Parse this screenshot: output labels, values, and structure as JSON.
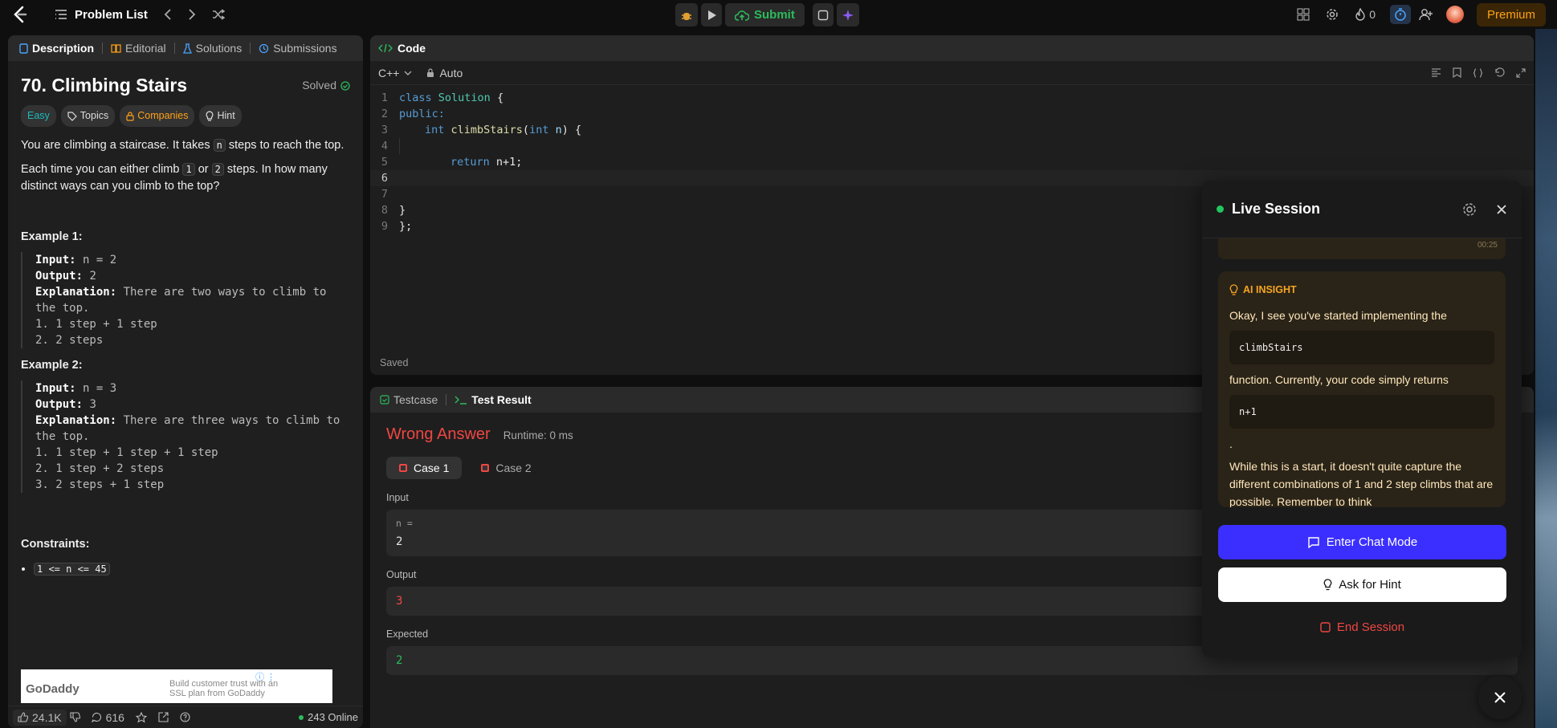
{
  "topbar": {
    "title": "Problem List",
    "submit": "Submit",
    "streak": "0",
    "premium": "Premium"
  },
  "left": {
    "tabs": [
      "Description",
      "Editorial",
      "Solutions",
      "Submissions"
    ],
    "title": "70. Climbing Stairs",
    "status": "Solved",
    "tags": [
      "Easy",
      "Topics",
      "Companies",
      "Hint"
    ],
    "p1a": "You are climbing a staircase. It takes ",
    "p1code": "n",
    "p1b": " steps to reach the top.",
    "p2a": "Each time you can either climb ",
    "p2c1": "1",
    "p2mid": " or ",
    "p2c2": "2",
    "p2b": " steps. In how many distinct ways can you climb to the top?",
    "ex1": {
      "h": "Example 1:",
      "input": "n = 2",
      "output": "2",
      "explain": "There are two ways to climb to the top.",
      "l1": "1. 1 step + 1 step",
      "l2": "2. 2 steps"
    },
    "ex2": {
      "h": "Example 2:",
      "input": "n = 3",
      "output": "3",
      "explain": "There are three ways to climb to the top.",
      "l1": "1. 1 step + 1 step + 1 step",
      "l2": "2. 1 step + 2 steps",
      "l3": "3. 2 steps + 1 step"
    },
    "labels": {
      "input": "Input:",
      "output": "Output:",
      "explanation": "Explanation:"
    },
    "constraints_h": "Constraints:",
    "constraint": "1 <= n <= 45",
    "ad": {
      "brand": "GoDaddy",
      "text": "Build customer trust with an SSL plan from GoDaddy"
    },
    "footer": {
      "likes": "24.1K",
      "comments": "616",
      "online": "243 Online"
    }
  },
  "code": {
    "header": "Code",
    "lang": "C++",
    "mode": "Auto",
    "saved": "Saved",
    "lines": {
      "l1a": "class ",
      "l1b": "Solution",
      " l1c": " {",
      "l2": "public:",
      "l3a": "int ",
      "l3b": "climbStairs",
      "l3c": "(",
      "l3d": "int ",
      "l3e": "n",
      ") {": ") {",
      "l5a": "return ",
      "l5b": "n+1;",
      "l8": "}",
      "l9": "};"
    }
  },
  "result": {
    "tab1": "Testcase",
    "tab2": "Test Result",
    "verdict": "Wrong Answer",
    "runtime": "Runtime: 0 ms",
    "case1": "Case 1",
    "case2": "Case 2",
    "input_label": "Input",
    "input_var": "n =",
    "input_val": "2",
    "output_label": "Output",
    "output_val": "3",
    "expected_label": "Expected",
    "expected_val": "2"
  },
  "live": {
    "title": "Live Session",
    "time": "00:25",
    "insight_label": "AI INSIGHT",
    "t1": "Okay, I see you've started implementing the",
    "c1": "climbStairs",
    "t2": "function. Currently, your code simply returns",
    "c2": "n+1",
    "t3": ".",
    "t4": "While this is a start, it doesn't quite capture the different combinations of 1 and 2 step climbs that are possible. Remember to think",
    "chat": "Enter Chat Mode",
    "hint": "Ask for Hint",
    "end": "End Session"
  },
  "colors": {
    "accent_orange": "#ffa116",
    "submit_green": "#2cbb5d",
    "wrong_red": "#ef4743",
    "chat_blue": "#3b2fff",
    "live_green": "#22c55e"
  }
}
